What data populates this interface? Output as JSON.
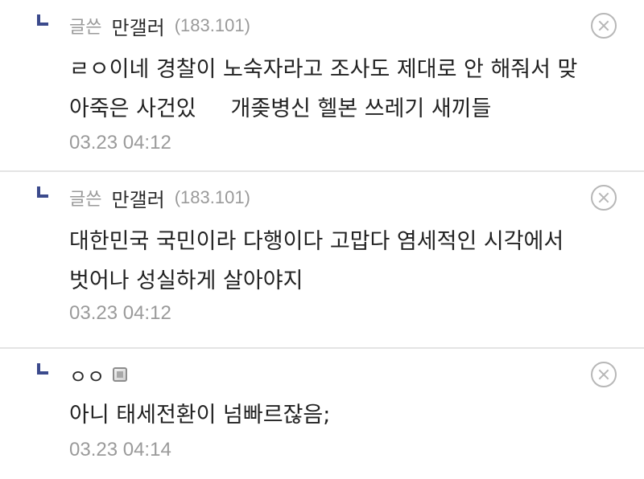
{
  "comments": [
    {
      "label": "글쓴",
      "nick": "만갤러",
      "ip": "(183.101)",
      "lines": [
        "ㄹㅇ이네 경찰이 노숙자라고 조사도 제대로 안 해줘서 맞",
        "아죽은 사건있     개좆병신 헬본 쓰레기 새끼들"
      ],
      "time": "03.23 04:12"
    },
    {
      "label": "글쓴",
      "nick": "만갤러",
      "ip": "(183.101)",
      "lines": [
        "대한민국 국민이라 다행이다 고맙다 염세적인 시각에서",
        "벗어나 성실하게 살아야지"
      ],
      "time": "03.23 04:12"
    },
    {
      "nick": "ㅇㅇ",
      "lines": [
        "아니 태세전환이 넘빠르잖음;"
      ],
      "time": "03.23 04:14"
    }
  ],
  "icons": {
    "reply": "reply-arrow-icon",
    "delete": "close-circle-icon",
    "gallog": "gallog-icon"
  },
  "colors": {
    "reply_mark": "#3b4a8c",
    "meta_text": "#9a9a9a",
    "divider": "#e4e4e4"
  }
}
